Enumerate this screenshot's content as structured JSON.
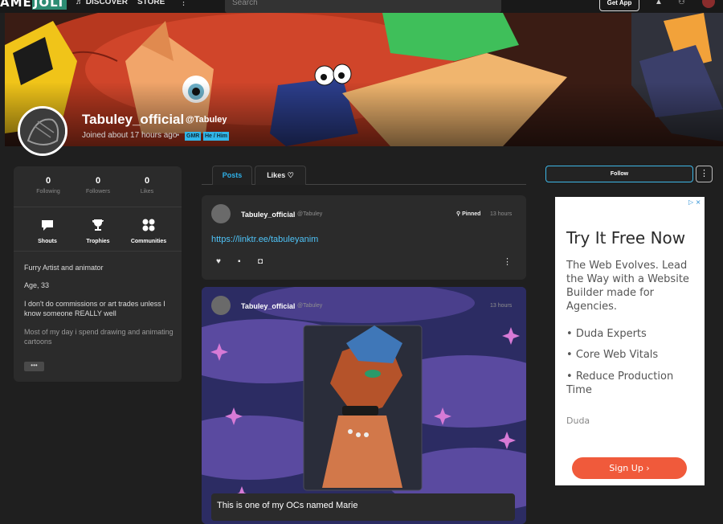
{
  "topnav": {
    "logo_left": "AME",
    "logo_right": "JOLT",
    "discover": "DISCOVER",
    "store": "STORE",
    "more": "⋮",
    "search_placeholder": "Search",
    "get_app": "Get App"
  },
  "profile": {
    "name": "Tabuley_official",
    "handle": "@Tabuley",
    "joined": "Joined about 17 hours ago",
    "tags": [
      "GMR",
      "He / Him"
    ]
  },
  "stats": [
    {
      "value": "0",
      "label": "Following"
    },
    {
      "value": "0",
      "label": "Followers"
    },
    {
      "value": "0",
      "label": "Likes"
    }
  ],
  "categories": [
    {
      "label": "Shouts",
      "icon": "shout-icon"
    },
    {
      "label": "Trophies",
      "icon": "trophy-icon"
    },
    {
      "label": "Communities",
      "icon": "communities-icon"
    }
  ],
  "bio": {
    "line1": "Furry Artist and animator",
    "line2": "Age, 33",
    "line3": "I don't do commissions or art trades unless I know someone REALLY well",
    "line4": "Most of my day i spend drawing and animating cartoons",
    "more": "•••"
  },
  "tabs": {
    "posts": "Posts",
    "likes": "Likes"
  },
  "posts": [
    {
      "author": "Tabuley_official",
      "handle": "@Tabuley",
      "pinned": "Pinned",
      "time": "13 hours",
      "link": "https://linktr.ee/tabuleyanim"
    },
    {
      "author": "Tabuley_official",
      "handle": "@Tabuley",
      "time": "13 hours",
      "caption": "This is one of my OCs named Marie"
    }
  ],
  "right": {
    "follow": "Follow",
    "menu": "⋮"
  },
  "ad": {
    "title": "Try It Free Now",
    "body": "The Web Evolves. Lead the Way with a Website Builder made for Agencies.",
    "bullets": [
      "Duda Experts",
      "Core Web Vitals",
      "Reduce Production Time"
    ],
    "brand": "Duda",
    "cta": "Sign Up ›"
  },
  "colors": {
    "accent": "#2fb0e8",
    "link": "#4fc3f7",
    "ad_cta": "#f05a3b"
  }
}
